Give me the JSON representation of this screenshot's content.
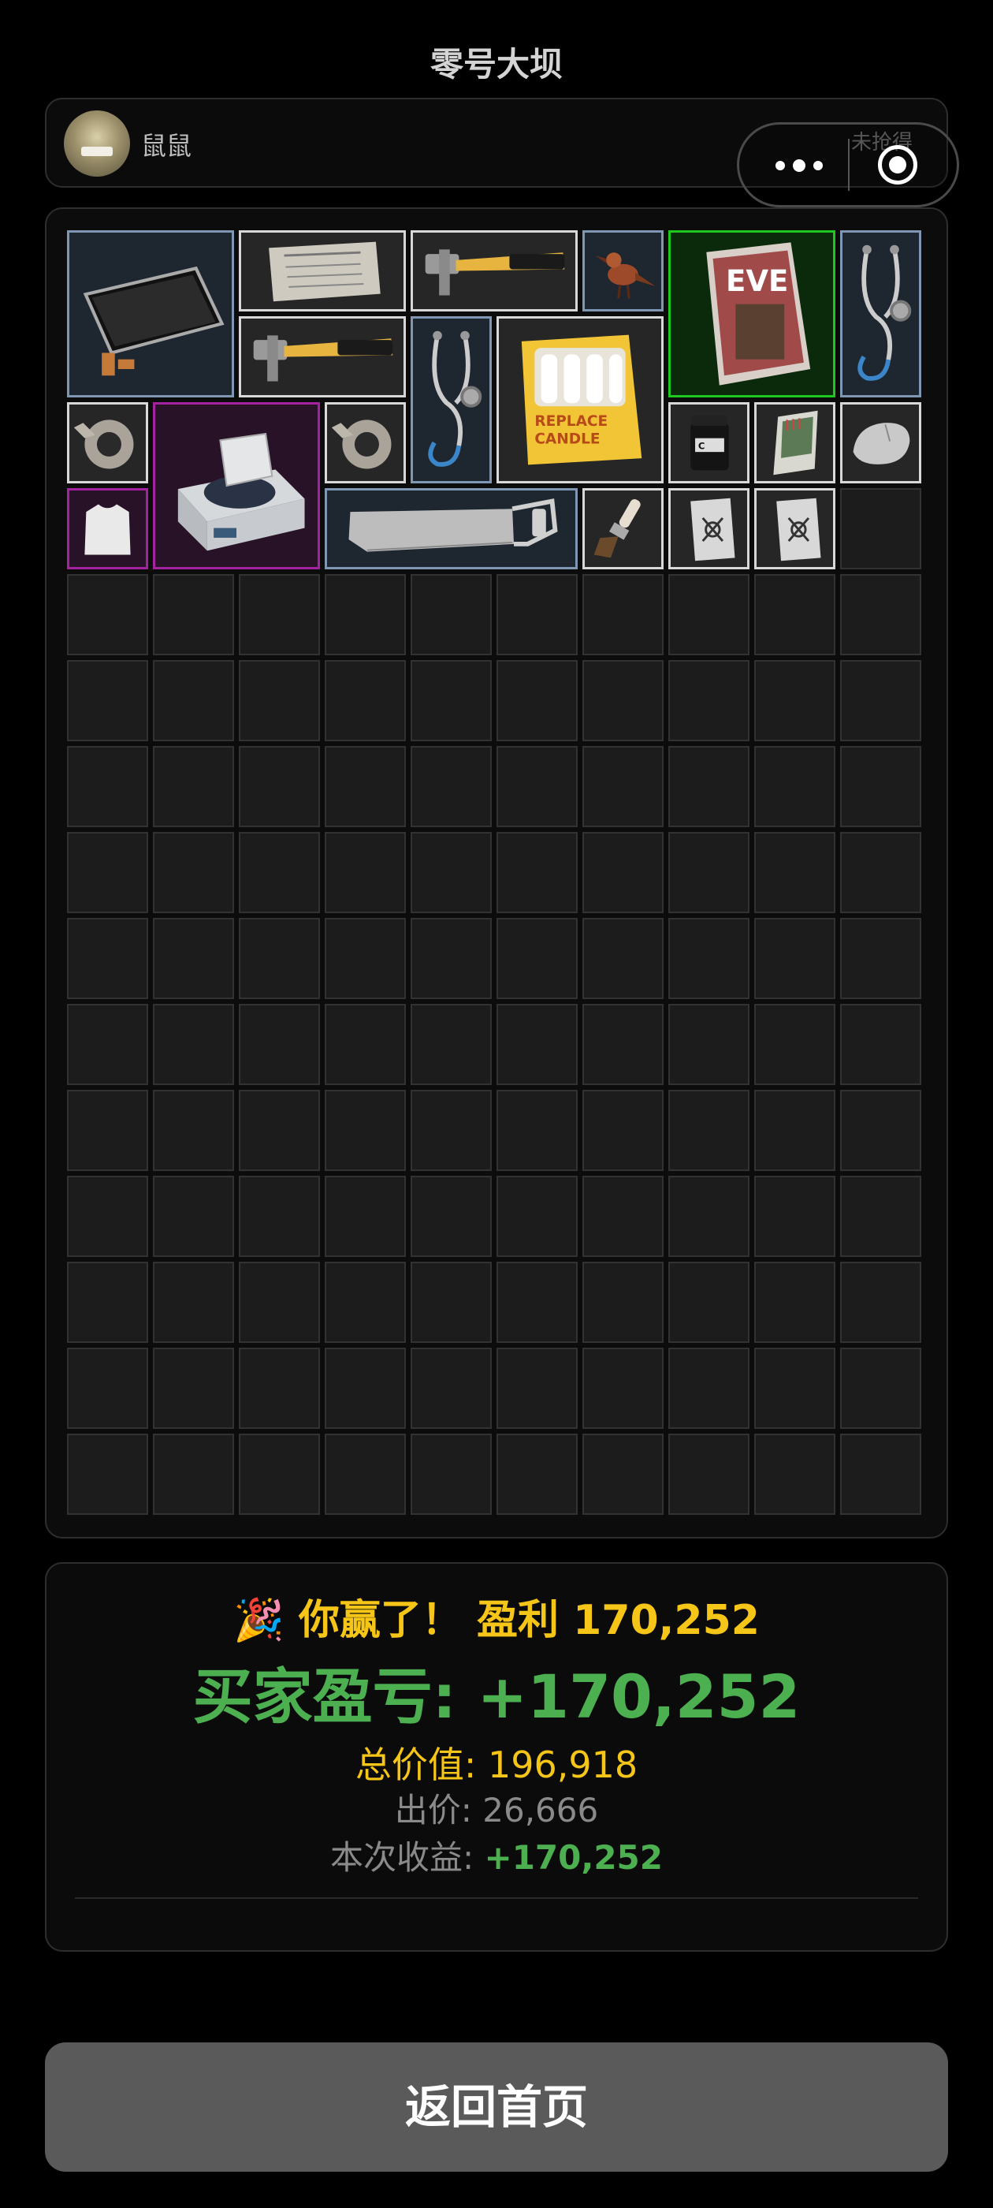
{
  "app": {
    "title": "零号大坝"
  },
  "user": {
    "name": "鼠鼠",
    "claim_status": "未抢得"
  },
  "capsule": {
    "more_icon": "more-dots-icon",
    "close_icon": "target-close-icon"
  },
  "inventory": {
    "columns": 10,
    "rows": 15,
    "items": [
      {
        "name": "display-panel",
        "rarity": "blue",
        "icon": "lcd-panel-icon"
      },
      {
        "name": "newspaper",
        "rarity": "white",
        "icon": "newspaper-icon"
      },
      {
        "name": "hammer",
        "rarity": "white",
        "icon": "hammer-icon"
      },
      {
        "name": "bird-figurine",
        "rarity": "blue",
        "icon": "bird-figurine-icon"
      },
      {
        "name": "magazine",
        "rarity": "green",
        "icon": "magazine-icon"
      },
      {
        "name": "stethoscope",
        "rarity": "blue",
        "icon": "stethoscope-icon"
      },
      {
        "name": "hammer",
        "rarity": "white",
        "icon": "hammer-icon"
      },
      {
        "name": "stethoscope",
        "rarity": "blue",
        "icon": "stethoscope-icon"
      },
      {
        "name": "candle-box",
        "rarity": "white",
        "icon": "candle-box-icon",
        "label_top": "REPLACE",
        "label_bottom": "CANDLE"
      },
      {
        "name": "tape-roll",
        "rarity": "white",
        "icon": "tape-roll-icon"
      },
      {
        "name": "centrifuge",
        "rarity": "purple",
        "icon": "centrifuge-icon"
      },
      {
        "name": "tape-roll",
        "rarity": "white",
        "icon": "tape-roll-icon"
      },
      {
        "name": "powder-jar",
        "rarity": "white",
        "icon": "powder-jar-icon"
      },
      {
        "name": "match-box",
        "rarity": "white",
        "icon": "match-box-icon"
      },
      {
        "name": "computer-mouse",
        "rarity": "white",
        "icon": "computer-mouse-icon"
      },
      {
        "name": "armor-plate",
        "rarity": "purple",
        "icon": "armor-plate-icon"
      },
      {
        "name": "hacksaw",
        "rarity": "blue",
        "icon": "hacksaw-icon"
      },
      {
        "name": "paint-brush",
        "rarity": "white",
        "icon": "paint-brush-icon"
      },
      {
        "name": "playing-card",
        "rarity": "white",
        "icon": "playing-card-icon"
      },
      {
        "name": "playing-card",
        "rarity": "white",
        "icon": "playing-card-icon"
      }
    ]
  },
  "result": {
    "win_icon": "party-popper-icon",
    "win_text": "你赢了！ 盈利 170,252",
    "buyer_line": "买家盈亏: +170,252",
    "total_line": "总价值: 196,918",
    "bid_line": "出价: 26,666",
    "income_label": "本次收益: ",
    "income_value": "+170,252"
  },
  "actions": {
    "home_button": "返回首页"
  }
}
